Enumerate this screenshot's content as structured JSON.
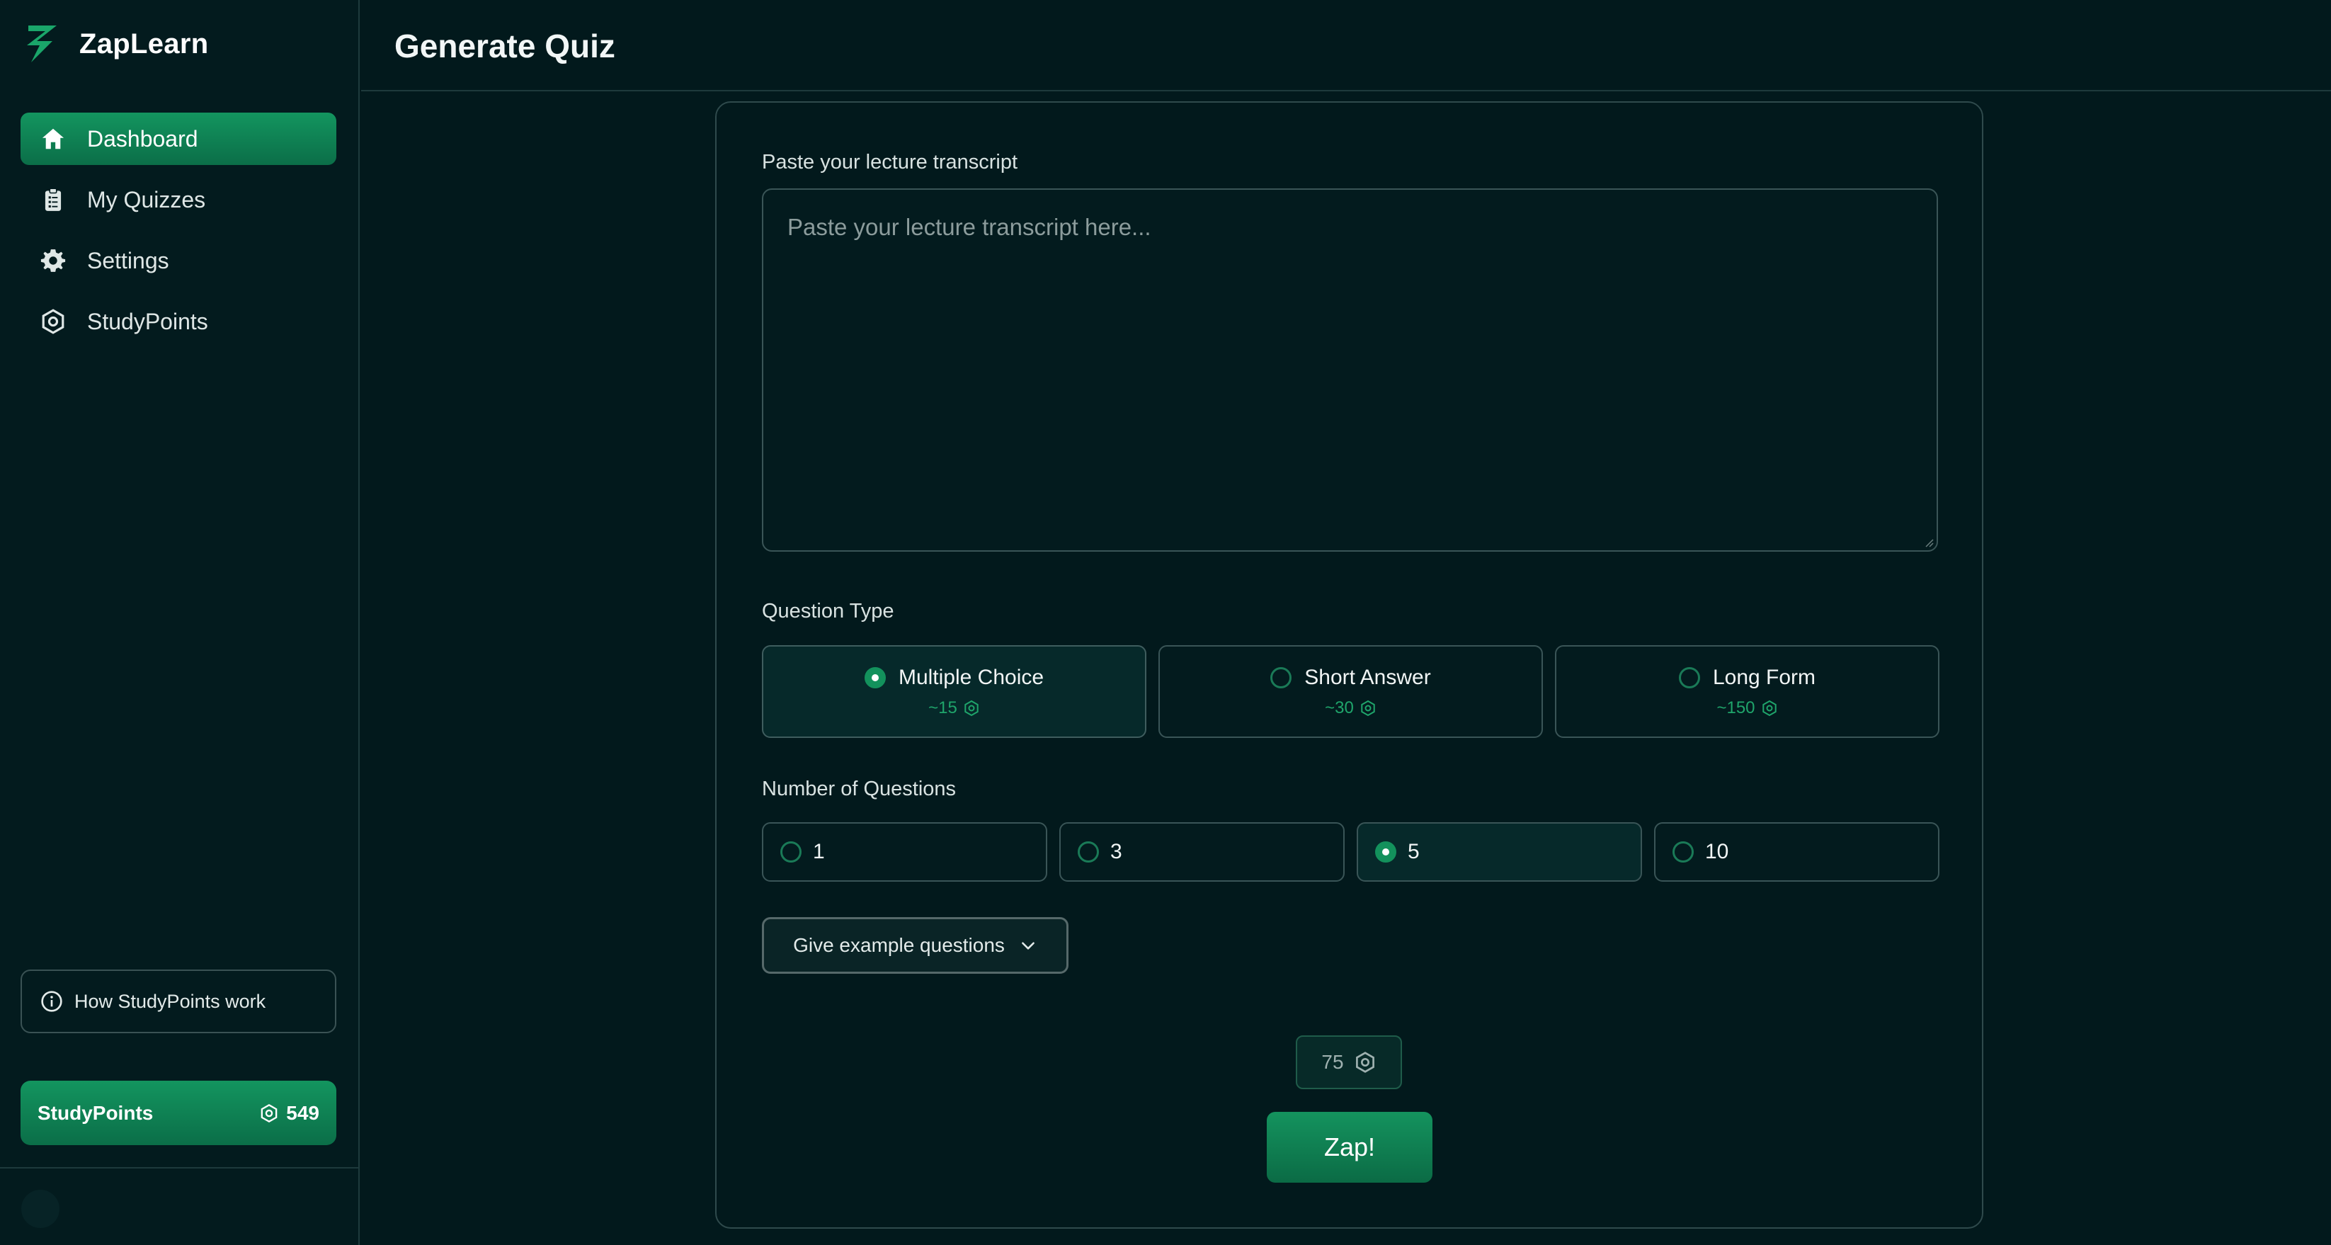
{
  "app": {
    "name": "ZapLearn"
  },
  "sidebar": {
    "items": [
      {
        "label": "Dashboard",
        "icon": "home-icon",
        "active": true
      },
      {
        "label": "My Quizzes",
        "icon": "clipboard-icon",
        "active": false
      },
      {
        "label": "Settings",
        "icon": "gear-icon",
        "active": false
      },
      {
        "label": "StudyPoints",
        "icon": "studypoints-icon",
        "active": false
      }
    ],
    "how_link": "How StudyPoints work",
    "studypoints": {
      "label": "StudyPoints",
      "value": "549"
    }
  },
  "header": {
    "title": "Generate Quiz"
  },
  "form": {
    "transcript_label": "Paste your lecture transcript",
    "transcript_placeholder": "Paste your lecture transcript here...",
    "transcript_value": "",
    "question_type_label": "Question Type",
    "question_types": [
      {
        "label": "Multiple Choice",
        "cost": "~15",
        "selected": true
      },
      {
        "label": "Short Answer",
        "cost": "~30",
        "selected": false
      },
      {
        "label": "Long Form",
        "cost": "~150",
        "selected": false
      }
    ],
    "num_questions_label": "Number of Questions",
    "num_questions": [
      {
        "label": "1",
        "selected": false
      },
      {
        "label": "3",
        "selected": false
      },
      {
        "label": "5",
        "selected": true
      },
      {
        "label": "10",
        "selected": false
      }
    ],
    "examples_button": "Give example questions",
    "total_cost": "75",
    "submit_label": "Zap!"
  },
  "colors": {
    "background": "#02191c",
    "accent": "#13955f",
    "accent_text": "#1fa56b",
    "border": "#3a5557"
  }
}
